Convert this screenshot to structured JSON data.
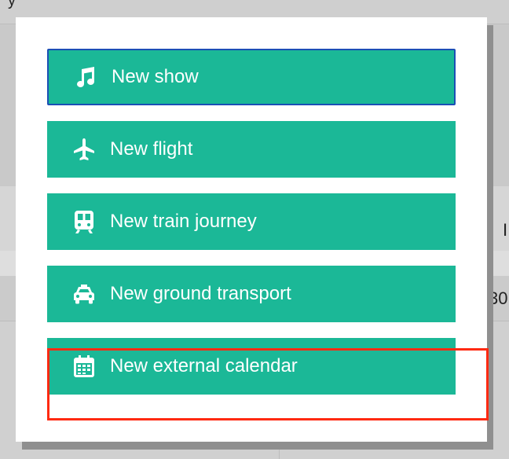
{
  "background": {
    "top_fragment": "y",
    "right_fragment_1": "I",
    "right_fragment_2": "30"
  },
  "menu": {
    "items": [
      {
        "label": "New show",
        "icon": "music-note-icon"
      },
      {
        "label": "New flight",
        "icon": "airplane-icon"
      },
      {
        "label": "New train journey",
        "icon": "train-icon"
      },
      {
        "label": "New ground transport",
        "icon": "taxi-icon"
      },
      {
        "label": "New external calendar",
        "icon": "calendar-icon"
      }
    ]
  },
  "colors": {
    "button_bg": "#1bb897",
    "button_text": "#ffffff",
    "focus_border": "#1b4fb5",
    "highlight": "#ff2a12"
  }
}
